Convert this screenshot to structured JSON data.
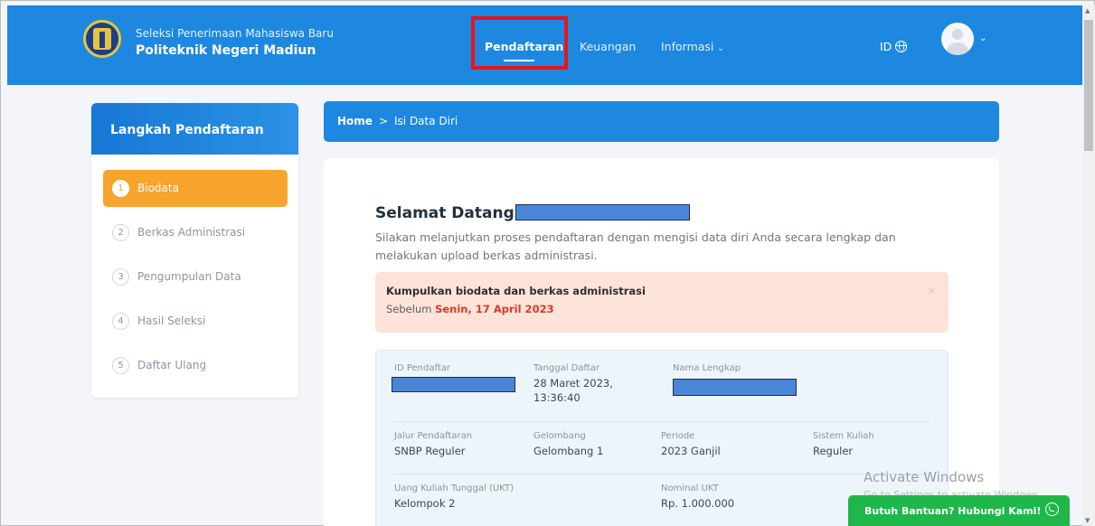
{
  "header": {
    "brand_subtitle": "Seleksi Penerimaan Mahasiswa Baru",
    "brand_title": "Politeknik Negeri Madiun",
    "nav": {
      "pendaftaran": "Pendaftaran",
      "keuangan": "Keuangan",
      "informasi": "Informasi"
    },
    "language": "ID"
  },
  "sidebar": {
    "title": "Langkah Pendaftaran",
    "steps": [
      {
        "num": "1",
        "label": "Biodata"
      },
      {
        "num": "2",
        "label": "Berkas Administrasi"
      },
      {
        "num": "3",
        "label": "Pengumpulan Data"
      },
      {
        "num": "4",
        "label": "Hasil Seleksi"
      },
      {
        "num": "5",
        "label": "Daftar Ulang"
      }
    ]
  },
  "breadcrumb": {
    "home": "Home",
    "separator": ">",
    "current": "Isi Data Diri"
  },
  "main": {
    "welcome": "Selamat Datang,",
    "intro": "Silakan melanjutkan proses pendaftaran dengan mengisi data diri Anda secara lengkap dan melakukan upload berkas administrasi.",
    "alert": {
      "title": "Kumpulkan biodata dan berkas administrasi",
      "prefix": "Sebelum",
      "deadline": "Senin, 17 April 2023",
      "close": "×"
    },
    "info": {
      "id_label": "ID Pendaftar",
      "tanggal_label": "Tanggal Daftar",
      "tanggal_value": "28 Maret 2023, 13:36:40",
      "nama_label": "Nama Lengkap",
      "jalur_label": "Jalur Pendaftaran",
      "jalur_value": "SNBP Reguler",
      "gelombang_label": "Gelombang",
      "gelombang_value": "Gelombang 1",
      "periode_label": "Periode",
      "periode_value": "2023 Ganjil",
      "sistem_label": "Sistem Kuliah",
      "sistem_value": "Reguler",
      "ukt_label": "Uang Kuliah Tunggal (UKT)",
      "ukt_value": "Kelompok 2",
      "nominal_label": "Nominal UKT",
      "nominal_value": "Rp. 1.000.000"
    }
  },
  "watermark": {
    "line1": "Activate Windows",
    "line2": "Go to Settings to activate Windows."
  },
  "help_button": "Butuh Bantuan? Hubungi Kami!",
  "colors": {
    "primary": "#1e88e0",
    "active_step": "#f8a52d",
    "alert_bg": "#fde3d8",
    "deadline": "#d93a2b",
    "help_button": "#1fb74a",
    "highlight": "#e8141a"
  }
}
